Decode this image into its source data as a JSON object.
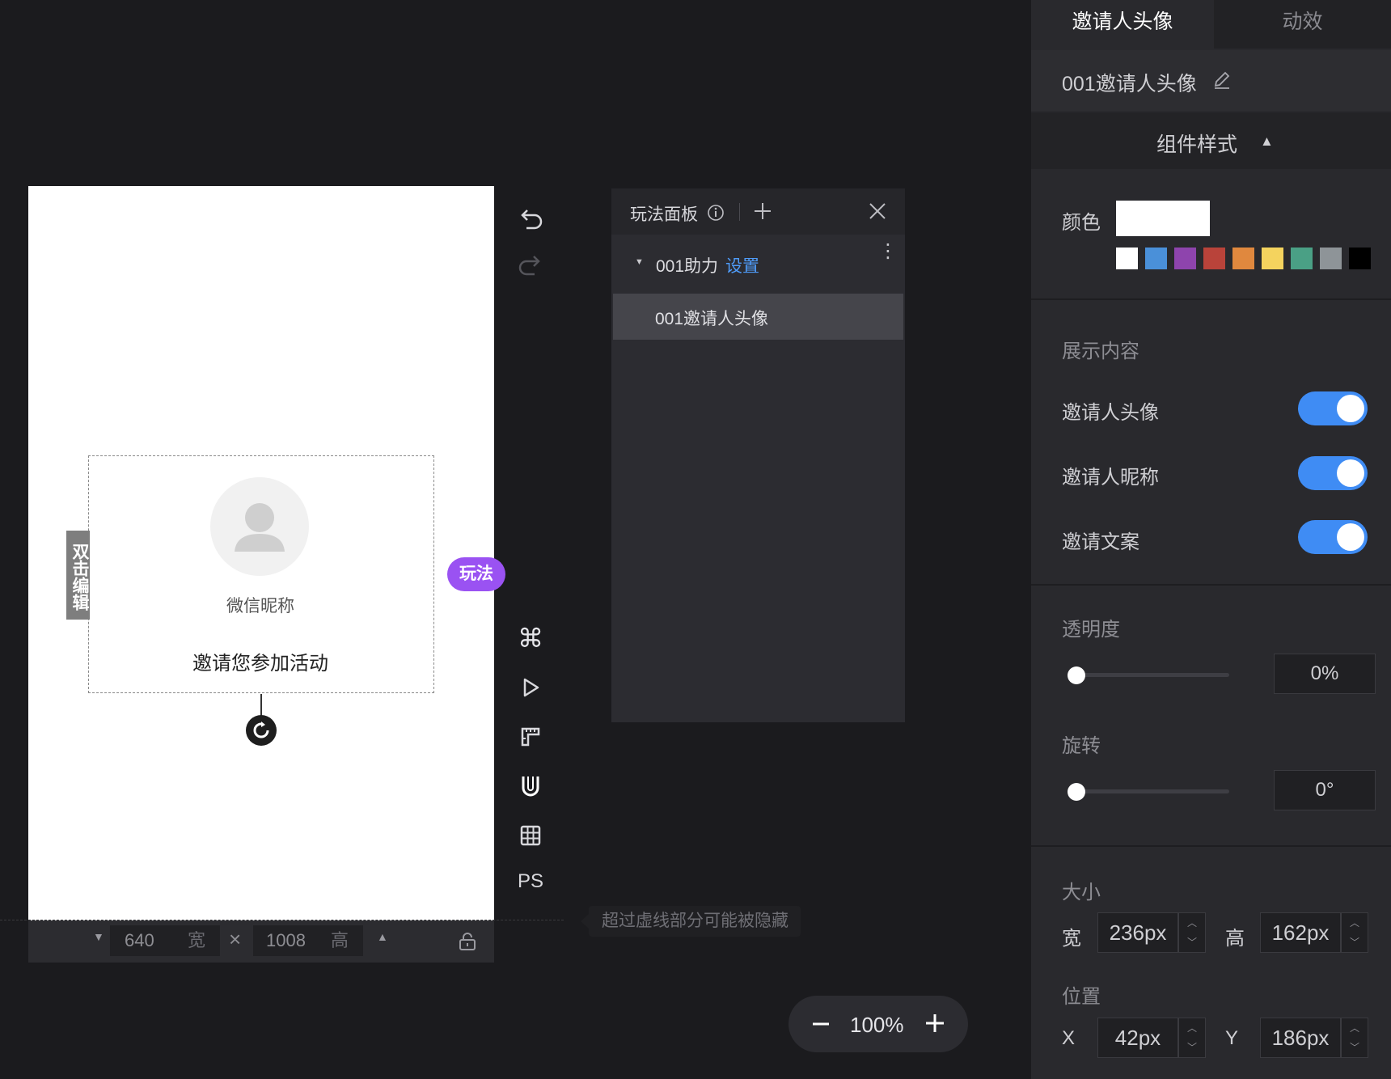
{
  "canvas": {
    "double_click_edit": "双击编辑",
    "play_tag": "玩法",
    "nickname": "微信昵称",
    "invite_text": "邀请您参加活动",
    "width_value": "640",
    "width_unit": "宽",
    "height_value": "1008",
    "height_unit": "高",
    "hint": "超过虚线部分可能被隐藏"
  },
  "tools": {
    "ps_label": "PS"
  },
  "play_panel": {
    "title": "玩法面板",
    "group_name": "001助力",
    "group_settings": "设置",
    "item_name": "001邀请人头像"
  },
  "zoom": {
    "level": "100%"
  },
  "inspector": {
    "tabs": [
      "邀请人头像",
      "动效"
    ],
    "component_name": "001邀请人头像",
    "section_style": "组件样式",
    "color_label": "颜色",
    "color_value": "#ffffff",
    "swatches": [
      "#ffffff",
      "#4a90d9",
      "#8e44ad",
      "#b9433a",
      "#e0883e",
      "#f4d35e",
      "#4aa085",
      "#8e9498",
      "#000000"
    ],
    "display_content": "展示内容",
    "toggles": [
      {
        "label": "邀请人头像",
        "on": true
      },
      {
        "label": "邀请人昵称",
        "on": true
      },
      {
        "label": "邀请文案",
        "on": true
      }
    ],
    "opacity_label": "透明度",
    "opacity_value": "0%",
    "rotate_label": "旋转",
    "rotate_value": "0°",
    "size_label": "大小",
    "width_label": "宽",
    "width_value": "236px",
    "height_label": "高",
    "height_value": "162px",
    "position_label": "位置",
    "x_label": "X",
    "x_value": "42px",
    "y_label": "Y",
    "y_value": "186px"
  }
}
